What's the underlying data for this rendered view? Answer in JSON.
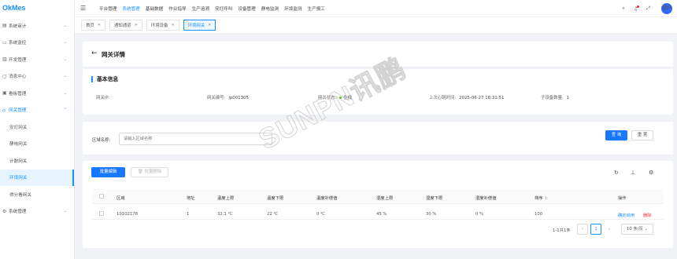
{
  "app": {
    "logo": "OkMes"
  },
  "sidebar": {
    "items": [
      {
        "label": "系统审计",
        "icon": "doc-icon",
        "chev": "⌄"
      },
      {
        "label": "系统监控",
        "icon": "monitor-icon",
        "chev": "⌄"
      },
      {
        "label": "开发管理",
        "icon": "code-icon",
        "chev": "⌄"
      },
      {
        "label": "消息中心",
        "icon": "message-icon",
        "chev": "⌄"
      },
      {
        "label": "看板管理",
        "icon": "board-icon",
        "chev": "⌄"
      },
      {
        "label": "网关管理",
        "icon": "gateway-icon",
        "chev": "⌃"
      }
    ],
    "subitems": [
      "安灯网关",
      "静电网关",
      "计数网关",
      "环境网关",
      "得分看网关"
    ],
    "last_item": {
      "label": "系统管理",
      "chev": "⌄"
    }
  },
  "topnav": [
    "平台管理",
    "系统管理",
    "基础数据",
    "作业指导",
    "生产追溯",
    "安灯呼叫",
    "设备管理",
    "静电监测",
    "环境监测",
    "生产报工"
  ],
  "top_avatar": "镭码",
  "tabs": [
    {
      "label": "首页"
    },
    {
      "label": "通知通道"
    },
    {
      "label": "环境设备"
    },
    {
      "label": "环境网关"
    }
  ],
  "detail": {
    "title": "网关详情"
  },
  "basic": {
    "section_title": "基本信息",
    "gateway_ip_label": "网关IP:",
    "gateway_no_label": "网关编号:",
    "gateway_no": "lp001305",
    "status_label": "网关状态:",
    "status": "在线",
    "heartbeat_label": "上次心跳时间:",
    "heartbeat": "2025-06-27 18:31:51",
    "subcount_label": "子设备数量:",
    "subcount": "1"
  },
  "filter": {
    "area_label": "区域名称:",
    "area_placeholder": "请输入区域名称",
    "query": "查 询",
    "reset": "重 置"
  },
  "table_actions": {
    "batch_edit": "批量编辑",
    "batch_delete": "批量删除"
  },
  "table": {
    "headers": [
      "区域",
      "地址",
      "温度上限",
      "温度下限",
      "温度补偿值",
      "湿度上限",
      "湿度下限",
      "湿度补偿值",
      "排序",
      "操作"
    ],
    "rows": [
      {
        "area": "10102178",
        "addr": "1",
        "t_hi": "32.1 ℃",
        "t_lo": "22 ℃",
        "t_comp": "0 ℃",
        "h_hi": "45 %",
        "h_lo": "30 %",
        "h_comp": "0 %",
        "sort": "100",
        "edit": "确定启用",
        "delete": "删除"
      }
    ]
  },
  "pagination": {
    "total": "1-1共1条",
    "current": "1",
    "size": "10 条/页"
  },
  "watermark": "SUNPN讯鹏",
  "colors": {
    "accent": "#1890ff",
    "online": "#52c41a",
    "danger": "#f5222d"
  }
}
